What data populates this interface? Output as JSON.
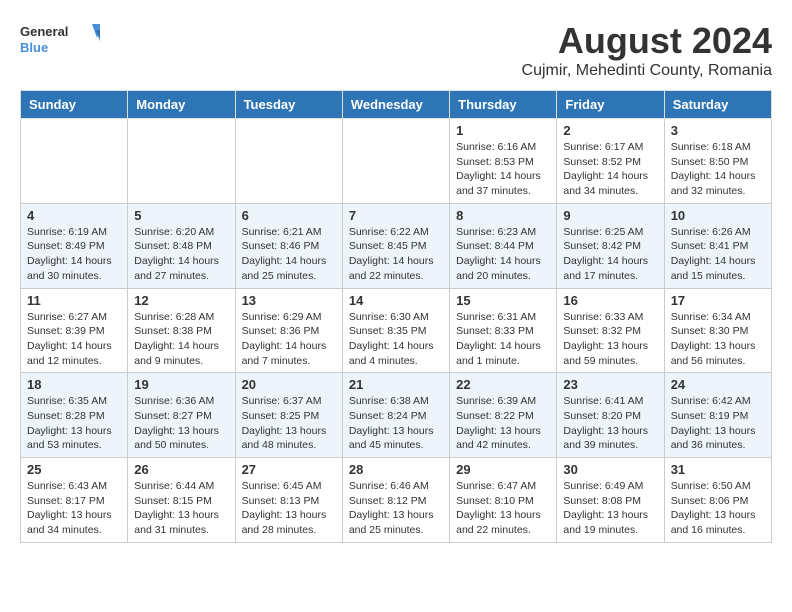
{
  "header": {
    "logo_general": "General",
    "logo_blue": "Blue",
    "main_title": "August 2024",
    "subtitle": "Cujmir, Mehedinti County, Romania"
  },
  "weekdays": [
    "Sunday",
    "Monday",
    "Tuesday",
    "Wednesday",
    "Thursday",
    "Friday",
    "Saturday"
  ],
  "weeks": [
    [
      {
        "date": "",
        "info": ""
      },
      {
        "date": "",
        "info": ""
      },
      {
        "date": "",
        "info": ""
      },
      {
        "date": "",
        "info": ""
      },
      {
        "date": "1",
        "info": "Sunrise: 6:16 AM\nSunset: 8:53 PM\nDaylight: 14 hours and 37 minutes."
      },
      {
        "date": "2",
        "info": "Sunrise: 6:17 AM\nSunset: 8:52 PM\nDaylight: 14 hours and 34 minutes."
      },
      {
        "date": "3",
        "info": "Sunrise: 6:18 AM\nSunset: 8:50 PM\nDaylight: 14 hours and 32 minutes."
      }
    ],
    [
      {
        "date": "4",
        "info": "Sunrise: 6:19 AM\nSunset: 8:49 PM\nDaylight: 14 hours and 30 minutes."
      },
      {
        "date": "5",
        "info": "Sunrise: 6:20 AM\nSunset: 8:48 PM\nDaylight: 14 hours and 27 minutes."
      },
      {
        "date": "6",
        "info": "Sunrise: 6:21 AM\nSunset: 8:46 PM\nDaylight: 14 hours and 25 minutes."
      },
      {
        "date": "7",
        "info": "Sunrise: 6:22 AM\nSunset: 8:45 PM\nDaylight: 14 hours and 22 minutes."
      },
      {
        "date": "8",
        "info": "Sunrise: 6:23 AM\nSunset: 8:44 PM\nDaylight: 14 hours and 20 minutes."
      },
      {
        "date": "9",
        "info": "Sunrise: 6:25 AM\nSunset: 8:42 PM\nDaylight: 14 hours and 17 minutes."
      },
      {
        "date": "10",
        "info": "Sunrise: 6:26 AM\nSunset: 8:41 PM\nDaylight: 14 hours and 15 minutes."
      }
    ],
    [
      {
        "date": "11",
        "info": "Sunrise: 6:27 AM\nSunset: 8:39 PM\nDaylight: 14 hours and 12 minutes."
      },
      {
        "date": "12",
        "info": "Sunrise: 6:28 AM\nSunset: 8:38 PM\nDaylight: 14 hours and 9 minutes."
      },
      {
        "date": "13",
        "info": "Sunrise: 6:29 AM\nSunset: 8:36 PM\nDaylight: 14 hours and 7 minutes."
      },
      {
        "date": "14",
        "info": "Sunrise: 6:30 AM\nSunset: 8:35 PM\nDaylight: 14 hours and 4 minutes."
      },
      {
        "date": "15",
        "info": "Sunrise: 6:31 AM\nSunset: 8:33 PM\nDaylight: 14 hours and 1 minute."
      },
      {
        "date": "16",
        "info": "Sunrise: 6:33 AM\nSunset: 8:32 PM\nDaylight: 13 hours and 59 minutes."
      },
      {
        "date": "17",
        "info": "Sunrise: 6:34 AM\nSunset: 8:30 PM\nDaylight: 13 hours and 56 minutes."
      }
    ],
    [
      {
        "date": "18",
        "info": "Sunrise: 6:35 AM\nSunset: 8:28 PM\nDaylight: 13 hours and 53 minutes."
      },
      {
        "date": "19",
        "info": "Sunrise: 6:36 AM\nSunset: 8:27 PM\nDaylight: 13 hours and 50 minutes."
      },
      {
        "date": "20",
        "info": "Sunrise: 6:37 AM\nSunset: 8:25 PM\nDaylight: 13 hours and 48 minutes."
      },
      {
        "date": "21",
        "info": "Sunrise: 6:38 AM\nSunset: 8:24 PM\nDaylight: 13 hours and 45 minutes."
      },
      {
        "date": "22",
        "info": "Sunrise: 6:39 AM\nSunset: 8:22 PM\nDaylight: 13 hours and 42 minutes."
      },
      {
        "date": "23",
        "info": "Sunrise: 6:41 AM\nSunset: 8:20 PM\nDaylight: 13 hours and 39 minutes."
      },
      {
        "date": "24",
        "info": "Sunrise: 6:42 AM\nSunset: 8:19 PM\nDaylight: 13 hours and 36 minutes."
      }
    ],
    [
      {
        "date": "25",
        "info": "Sunrise: 6:43 AM\nSunset: 8:17 PM\nDaylight: 13 hours and 34 minutes."
      },
      {
        "date": "26",
        "info": "Sunrise: 6:44 AM\nSunset: 8:15 PM\nDaylight: 13 hours and 31 minutes."
      },
      {
        "date": "27",
        "info": "Sunrise: 6:45 AM\nSunset: 8:13 PM\nDaylight: 13 hours and 28 minutes."
      },
      {
        "date": "28",
        "info": "Sunrise: 6:46 AM\nSunset: 8:12 PM\nDaylight: 13 hours and 25 minutes."
      },
      {
        "date": "29",
        "info": "Sunrise: 6:47 AM\nSunset: 8:10 PM\nDaylight: 13 hours and 22 minutes."
      },
      {
        "date": "30",
        "info": "Sunrise: 6:49 AM\nSunset: 8:08 PM\nDaylight: 13 hours and 19 minutes."
      },
      {
        "date": "31",
        "info": "Sunrise: 6:50 AM\nSunset: 8:06 PM\nDaylight: 13 hours and 16 minutes."
      }
    ]
  ]
}
